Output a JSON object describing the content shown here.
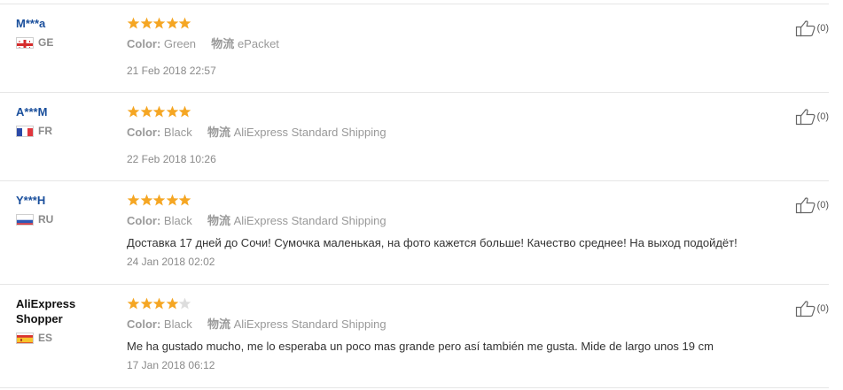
{
  "reviews": [
    {
      "name": "M***a",
      "country": "GE",
      "flag": "georgia-flag-icon",
      "rating": 5,
      "color_label": "Color:",
      "color": "Green",
      "shipping_label": "物流",
      "shipping": "ePacket",
      "text": "",
      "date": "21 Feb 2018 22:57",
      "likes": "(0)"
    },
    {
      "name": "A***M",
      "country": "FR",
      "flag": "france-flag-icon",
      "rating": 5,
      "color_label": "Color:",
      "color": "Black",
      "shipping_label": "物流",
      "shipping": "AliExpress Standard Shipping",
      "text": "",
      "date": "22 Feb 2018 10:26",
      "likes": "(0)"
    },
    {
      "name": "Y***H",
      "country": "RU",
      "flag": "russia-flag-icon",
      "rating": 5,
      "color_label": "Color:",
      "color": "Black",
      "shipping_label": "物流",
      "shipping": "AliExpress Standard Shipping",
      "text": "Доставка 17 дней до Сочи! Сумочка маленькая, на фото кажется больше! Качество среднее! На выход подойдёт!",
      "date": "24 Jan 2018 02:02",
      "likes": "(0)"
    },
    {
      "name": "AliExpress Shopper",
      "country": "ES",
      "flag": "spain-flag-icon",
      "rating": 4,
      "color_label": "Color:",
      "color": "Black",
      "shipping_label": "物流",
      "shipping": "AliExpress Standard Shipping",
      "text": "Me ha gustado mucho, me lo esperaba un poco mas grande pero así también me gusta. Mide de largo unos 19 cm",
      "date": "17 Jan 2018 06:12",
      "likes": "(0)"
    }
  ],
  "colors": {
    "username": "#1a4f9c",
    "star_on": "#f5a623",
    "star_off": "#dddddd",
    "meta": "#999999"
  }
}
